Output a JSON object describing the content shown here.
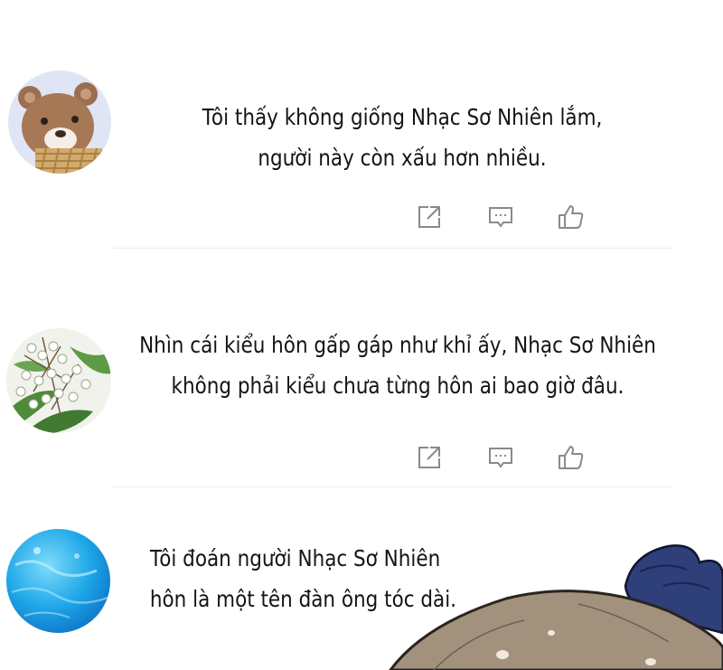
{
  "comments": [
    {
      "avatar": "bear-avatar",
      "lines": [
        "Tôi thấy không giống Nhạc Sơ Nhiên lắm,",
        "người này còn xấu hơn nhiều."
      ],
      "actions": [
        "share-icon",
        "comment-icon",
        "like-icon"
      ]
    },
    {
      "avatar": "flower-avatar",
      "lines": [
        "Nhìn cái kiểu hôn gấp gáp như khỉ ấy, Nhạc Sơ Nhiên",
        "không phải kiểu chưa từng hôn ai bao giờ đâu."
      ],
      "actions": [
        "share-icon",
        "comment-icon",
        "like-icon"
      ]
    },
    {
      "avatar": "water-avatar",
      "lines": [
        "Tôi đoán người Nhạc Sơ Nhiên",
        "hôn là một tên đàn ông tóc dài."
      ],
      "actions": []
    }
  ],
  "colors": {
    "text": "#141414",
    "icon": "#8a8a8a",
    "divider": "#ededed",
    "background": "#ffffff"
  }
}
